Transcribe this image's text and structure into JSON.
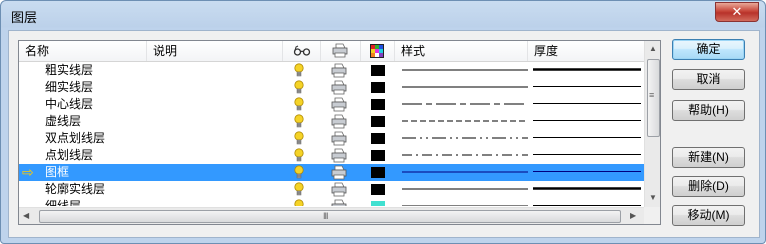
{
  "window": {
    "title": "图层",
    "close_glyph": "✕"
  },
  "columns": {
    "name": "名称",
    "description": "说明",
    "visible_icon": "glasses-icon",
    "print_icon": "printer-icon",
    "color_icon": "color-palette-icon",
    "style": "样式",
    "thickness": "厚度"
  },
  "layers": [
    {
      "name": "粗实线层",
      "style": "solid",
      "thickness": "thick",
      "color": "#000000",
      "selected": false,
      "current": false
    },
    {
      "name": "细实线层",
      "style": "solid",
      "thickness": "thin",
      "color": "#000000",
      "selected": false,
      "current": false
    },
    {
      "name": "中心线层",
      "style": "center",
      "thickness": "thin",
      "color": "#000000",
      "selected": false,
      "current": false
    },
    {
      "name": "虚线层",
      "style": "dashed",
      "thickness": "thin",
      "color": "#000000",
      "selected": false,
      "current": false
    },
    {
      "name": "双点划线层",
      "style": "double-dot-dash",
      "thickness": "thin",
      "color": "#000000",
      "selected": false,
      "current": false
    },
    {
      "name": "点划线层",
      "style": "dot-dash",
      "thickness": "thin",
      "color": "#000000",
      "selected": false,
      "current": false
    },
    {
      "name": "图框",
      "style": "solid",
      "thickness": "thin",
      "color": "#000000",
      "selected": true,
      "current": true
    },
    {
      "name": "轮廓实线层",
      "style": "solid",
      "thickness": "thick",
      "color": "#000000",
      "selected": false,
      "current": false
    },
    {
      "name": "细线层",
      "style": "solid",
      "thickness": "thin",
      "color": "#40e0d0",
      "selected": false,
      "current": false
    }
  ],
  "buttons": {
    "ok": "确定",
    "cancel": "取消",
    "help": "帮助(H)",
    "new": "新建(N)",
    "delete": "删除(D)",
    "move": "移动(M)"
  },
  "scrollbar": {
    "grip": "III",
    "vgrip": "≡"
  },
  "colors": {
    "selection": "#3399ff",
    "bulb": "#f5d327",
    "current_arrow": "#ffcc00"
  }
}
